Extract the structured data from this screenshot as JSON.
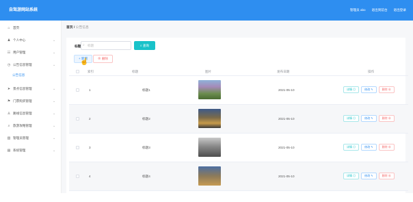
{
  "header": {
    "logo": "自驾游网站系统",
    "admin": "管理员 abo",
    "home_link": "退出到前台",
    "logout": "退出登录"
  },
  "sidebar": {
    "items": [
      {
        "icon": "home-icon",
        "glyph": "⌂",
        "label": "首页",
        "has_chevron": false
      },
      {
        "icon": "user-icon",
        "glyph": "♟",
        "label": "个人中心",
        "has_chevron": true
      },
      {
        "icon": "users-icon",
        "glyph": "☷",
        "label": "用户管理",
        "has_chevron": true
      },
      {
        "icon": "clock-icon",
        "glyph": "◷",
        "label": "公告信息管理",
        "has_chevron": true
      },
      {
        "icon": "send-icon",
        "glyph": "➤",
        "label": "景点信息管理",
        "has_chevron": true
      },
      {
        "icon": "flag-icon",
        "glyph": "⚑",
        "label": "门票购买管理",
        "has_chevron": true
      },
      {
        "icon": "person-icon",
        "glyph": "♙",
        "label": "路线信息管理",
        "has_chevron": true
      },
      {
        "icon": "search-icon",
        "glyph": "⌕",
        "label": "旅游攻略管理",
        "has_chevron": true
      },
      {
        "icon": "chart-icon",
        "glyph": "▥",
        "label": "管理员管理",
        "has_chevron": true
      },
      {
        "icon": "system-icon",
        "glyph": "▤",
        "label": "系统管理",
        "has_chevron": true
      }
    ],
    "sub_item": "公告信息"
  },
  "breadcrumb": {
    "home": "首页",
    "sep": "/",
    "current": "公告信息"
  },
  "search": {
    "label": "标题",
    "placeholder": "标题",
    "button": "查询"
  },
  "actions": {
    "add": "新增",
    "delete": "删除"
  },
  "table": {
    "headers": {
      "index": "索引",
      "title": "标题",
      "image": "图片",
      "date": "发布日期",
      "ops": "操作"
    },
    "rows": [
      {
        "index": "1",
        "title": "标题1",
        "date": "2021-05-10"
      },
      {
        "index": "2",
        "title": "标题2",
        "date": "2021-05-10"
      },
      {
        "index": "3",
        "title": "标题3",
        "date": "2021-05-10"
      },
      {
        "index": "4",
        "title": "标题4",
        "date": "2021-05-10"
      }
    ],
    "op_labels": {
      "view": "详情 ◎",
      "edit": "修改 ✎",
      "del": "删除 ⊗"
    }
  },
  "colors": {
    "accent": "#2e8ef0",
    "teal": "#19c2c9",
    "danger": "#f56c6c"
  }
}
